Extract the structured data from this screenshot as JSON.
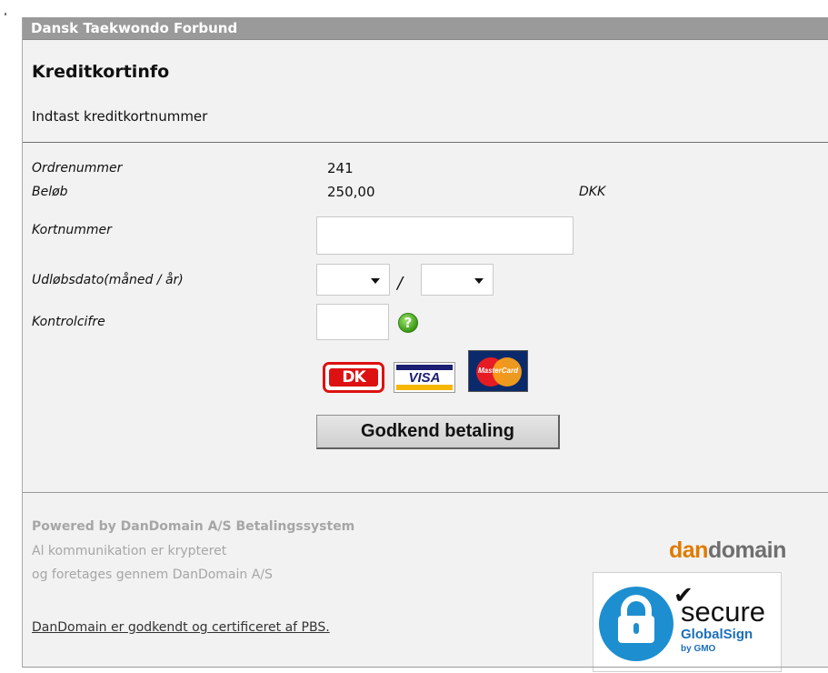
{
  "titlebar": {
    "title": "Dansk Taekwondo Forbund"
  },
  "header": {
    "heading": "Kreditkortinfo",
    "subheading": "Indtast kreditkortnummer"
  },
  "form": {
    "order_label": "Ordrenummer",
    "order_value": "241",
    "amount_label": "Beløb",
    "amount_value": "250,00",
    "currency": "DKK",
    "card_label": "Kortnummer",
    "card_value": "",
    "expiry_label": "Udløbsdato(måned / år)",
    "expiry_month": "",
    "expiry_year": "",
    "expiry_separator": "/",
    "cvc_label": "Kontrolcifre",
    "cvc_value": "",
    "help_icon": "?",
    "submit_label": "Godkend betaling"
  },
  "cards": {
    "dk": "DK",
    "visa": "VISA",
    "mastercard": "MasterCard"
  },
  "footer": {
    "powered_by": "Powered by DanDomain A/S Betalingssystem",
    "line1": "Al kommunikation er krypteret",
    "line2": "og foretages gennem DanDomain A/S",
    "certified_link": "DanDomain er godkendt og certificeret af PBS."
  },
  "logos": {
    "dandomain_part1": "dan",
    "dandomain_part2": "domain",
    "secure_word": "secure",
    "globalsign": "GlobalSign",
    "gmo": "by GMO"
  },
  "colors": {
    "titlebar_bg": "#9a9a9a",
    "panel_bg": "#f2f2f2",
    "dk_red": "#dd1111",
    "visa_blue": "#1a1f71",
    "dandomain_orange": "#e07b00",
    "globalsign_blue": "#1d8fd0"
  }
}
